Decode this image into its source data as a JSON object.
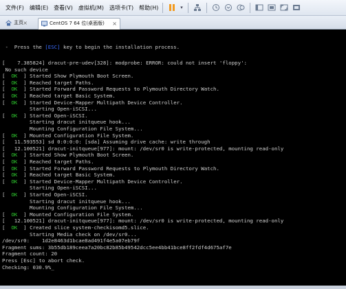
{
  "menu": [
    "文件(F)",
    "编辑(E)",
    "查看(V)",
    "虚拟机(M)",
    "选项卡(T)",
    "帮助(H)"
  ],
  "tabs": {
    "home": "主页",
    "active": "CentOS 7 64 位(桌面版)"
  },
  "colors": {
    "ok": "#2fd02f",
    "key_highlight": "#3a6cff",
    "console_text": "#cfcfcf",
    "pause": "#f29a1e"
  },
  "console": {
    "prompt": {
      "before": " -  Press the ",
      "key": "[ESC]",
      "after": " key to begin the installation process."
    },
    "lines": [
      {
        "ok": false,
        "text": "[    7.385824] dracut-pre-udev[328]: modprobe: ERROR: could not insert 'floppy':"
      },
      {
        "ok": false,
        "text": " No such device"
      },
      {
        "ok": true,
        "text": "Started Show Plymouth Boot Screen."
      },
      {
        "ok": true,
        "text": "Reached target Paths."
      },
      {
        "ok": true,
        "text": "Started Forward Password Requests to Plymouth Directory Watch."
      },
      {
        "ok": true,
        "text": "Reached target Basic System."
      },
      {
        "ok": true,
        "text": "Started Device-Mapper Multipath Device Controller."
      },
      {
        "ok": false,
        "text": "         Starting Open-iSCSI..."
      },
      {
        "ok": true,
        "text": "Started Open-iSCSI."
      },
      {
        "ok": false,
        "text": "         Starting dracut initqueue hook..."
      },
      {
        "ok": false,
        "text": "         Mounting Configuration File System..."
      },
      {
        "ok": true,
        "text": "Mounted Configuration File System."
      },
      {
        "ok": false,
        "text": "[   11.593553] sd 0:0:0:0: [sda] Assuming drive cache: write through"
      },
      {
        "ok": false,
        "text": "[   12.100521] dracut-initqueue[977]: mount: /dev/sr0 is write-protected, mounting read-only"
      },
      {
        "ok": true,
        "text": "Started Show Plymouth Boot Screen."
      },
      {
        "ok": true,
        "text": "Reached target Paths."
      },
      {
        "ok": true,
        "text": "Started Forward Password Requests to Plymouth Directory Watch."
      },
      {
        "ok": true,
        "text": "Reached target Basic System."
      },
      {
        "ok": true,
        "text": "Started Device-Mapper Multipath Device Controller."
      },
      {
        "ok": false,
        "text": "         Starting Open-iSCSI..."
      },
      {
        "ok": true,
        "text": "Started Open-iSCSI."
      },
      {
        "ok": false,
        "text": "         Starting dracut initqueue hook..."
      },
      {
        "ok": false,
        "text": "         Mounting Configuration File System..."
      },
      {
        "ok": true,
        "text": "Mounted Configuration File System."
      },
      {
        "ok": false,
        "text": "[   12.100521] dracut-initqueue[977]: mount: /dev/sr0 is write-protected, mounting read-only"
      },
      {
        "ok": true,
        "text": "Created slice system-checkisomd5.slice."
      },
      {
        "ok": false,
        "text": "         Starting Media check on /dev/sr0..."
      },
      {
        "ok": false,
        "text": "/dev/sr0:    1d2e8463d1bcae8ad491f4e5a07eb79f"
      },
      {
        "ok": false,
        "text": "Fragment sums: 3b55db189ceea7a20bc82b85b49542dcc5ee4bb41bce8ff2fdf4d675af7e"
      },
      {
        "ok": false,
        "text": "Fragment count: 20"
      },
      {
        "ok": false,
        "text": "Press [Esc] to abort check."
      },
      {
        "ok": false,
        "text": "Checking: 030.9%_"
      }
    ]
  }
}
